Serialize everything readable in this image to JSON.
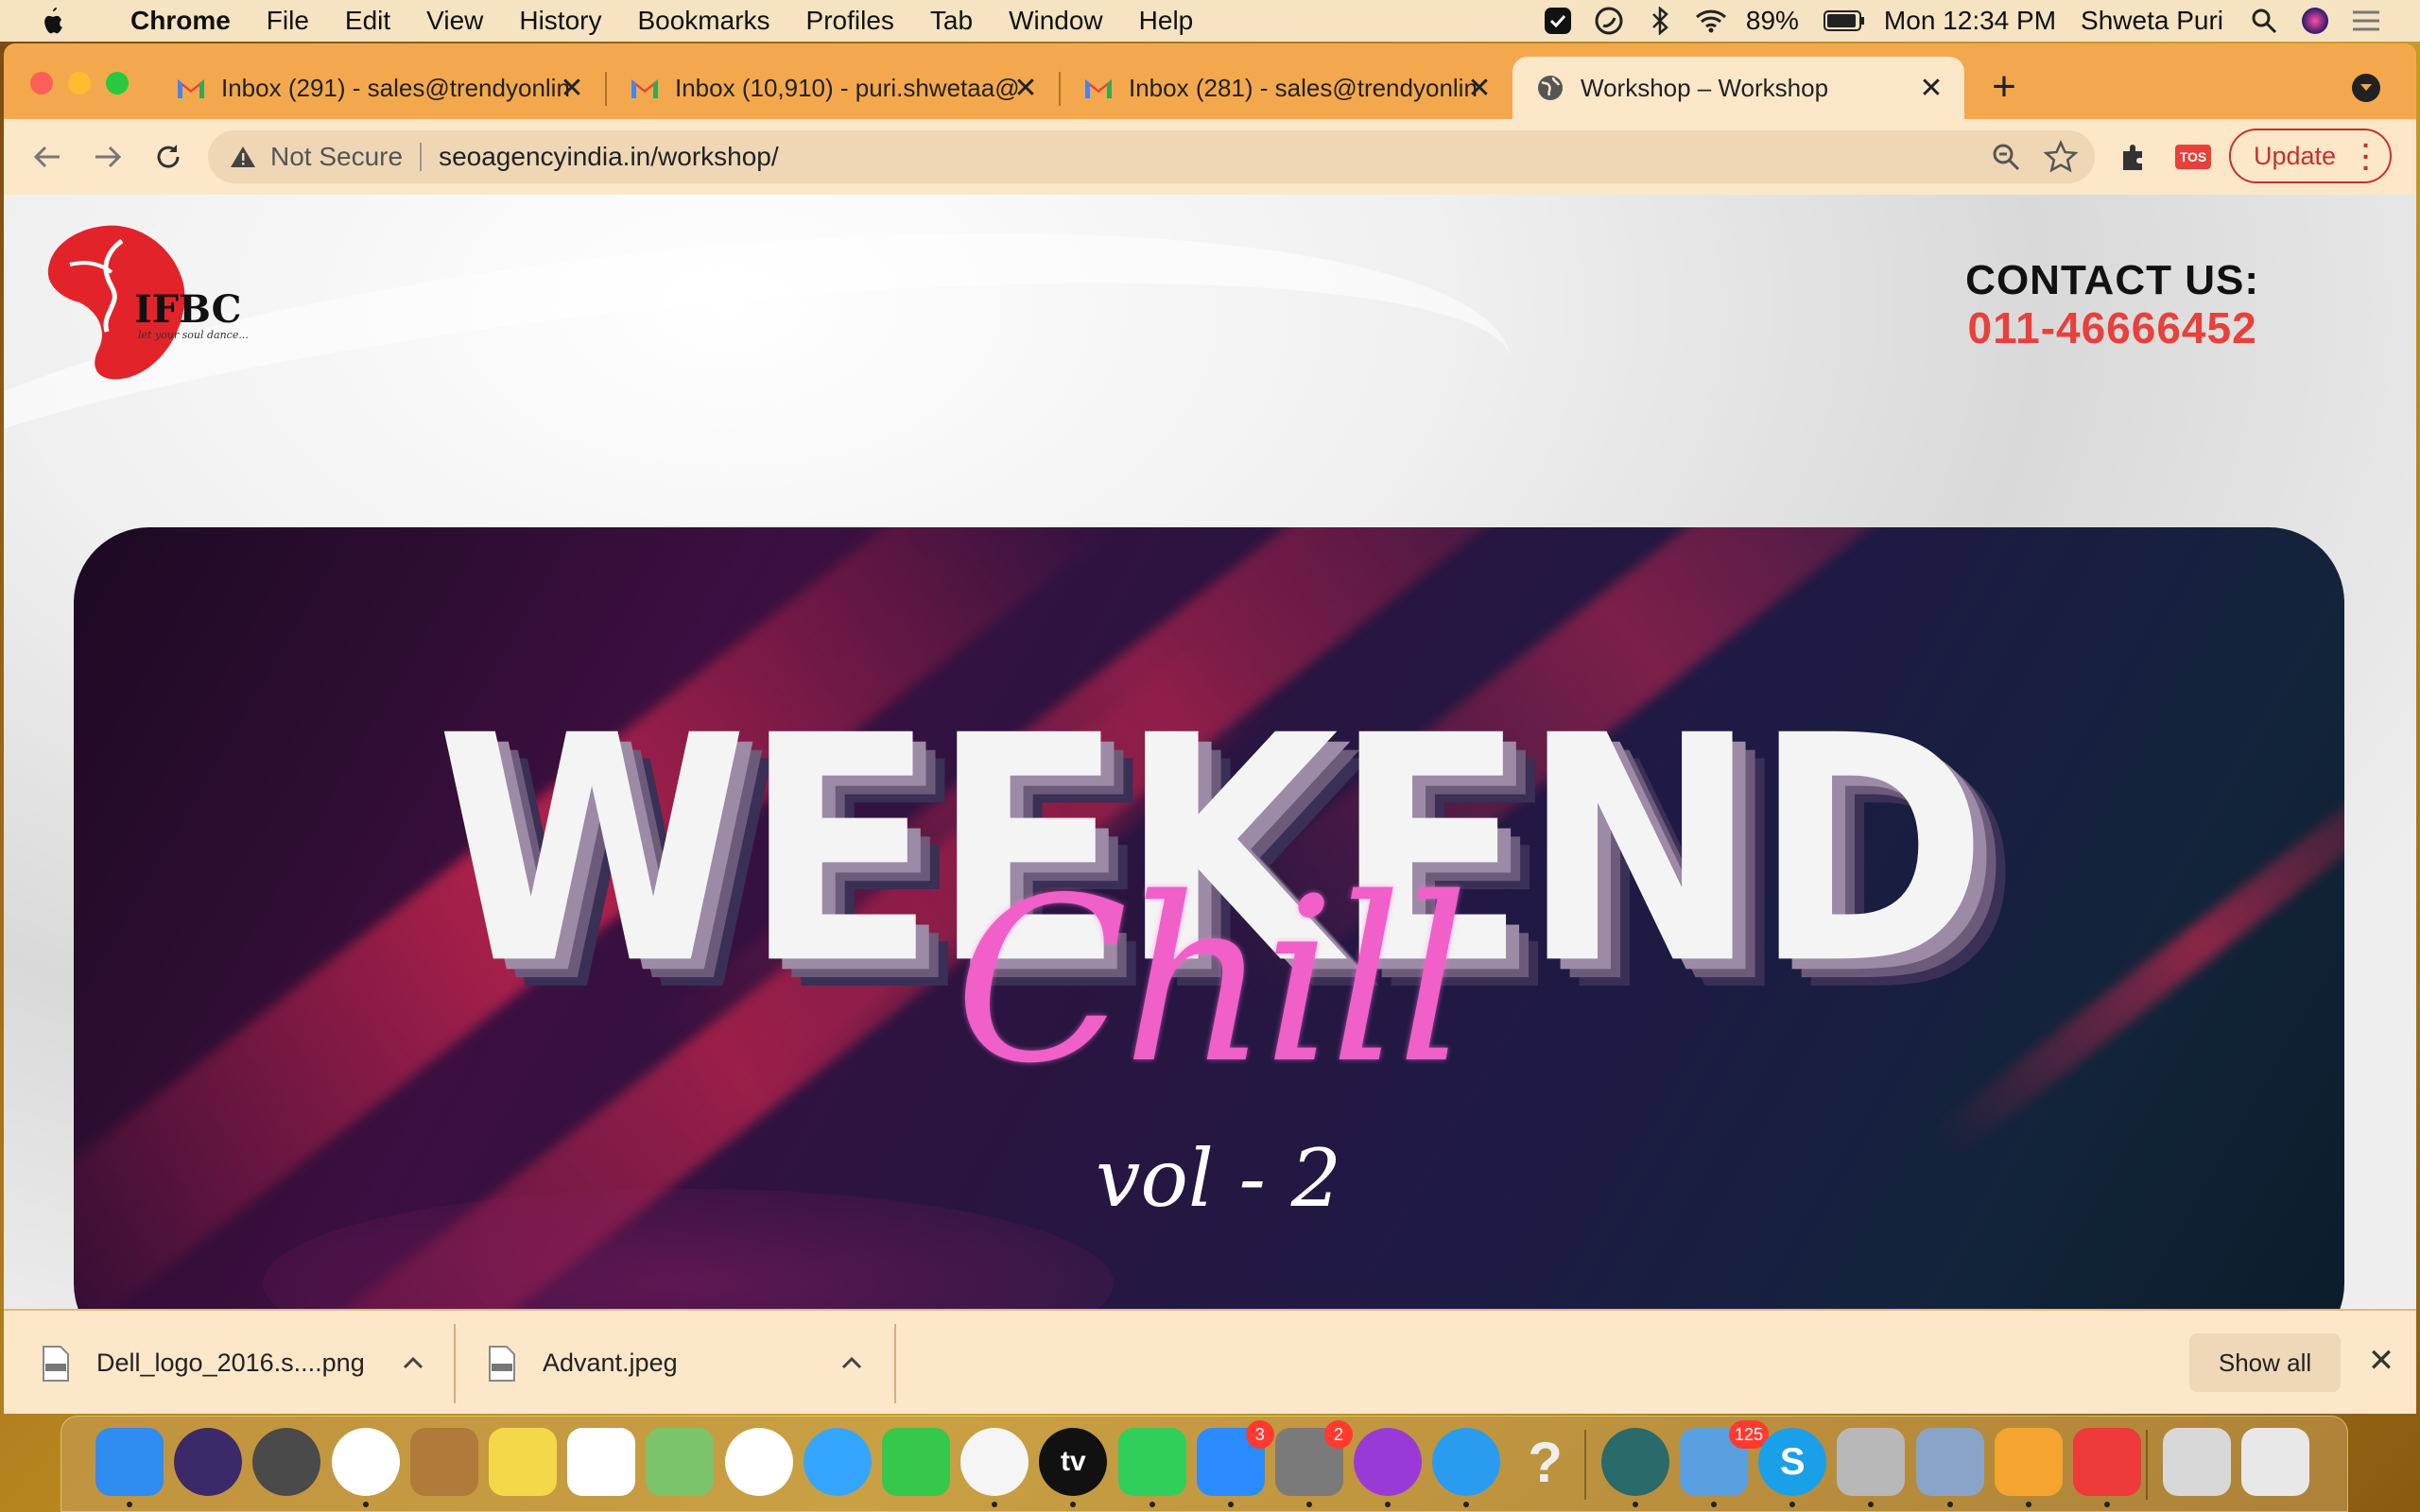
{
  "menubar": {
    "app_name": "Chrome",
    "items": [
      "File",
      "Edit",
      "View",
      "History",
      "Bookmarks",
      "Profiles",
      "Tab",
      "Window",
      "Help"
    ],
    "battery": "89%",
    "clock": "Mon 12:34 PM",
    "user": "Shweta Puri"
  },
  "tabs": [
    {
      "title": "Inbox (291) - sales@trendyonline",
      "icon": "gmail-icon"
    },
    {
      "title": "Inbox (10,910) - puri.shwetaa@",
      "icon": "gmail-icon"
    },
    {
      "title": "Inbox (281) - sales@trendyonline",
      "icon": "gmail-icon"
    },
    {
      "title": "Workshop – Workshop",
      "icon": "globe-icon",
      "active": true
    }
  ],
  "omnibox": {
    "security": "Not Secure",
    "url": "seoagencyindia.in/workshop/"
  },
  "toolbar": {
    "update_label": "Update",
    "extension_label": "TOS"
  },
  "page": {
    "logo_text": "IFBC",
    "logo_tagline": "let your soul dance...",
    "contact_label": "CONTACT US:",
    "contact_phone": "011-46666452",
    "banner": {
      "headline": "WEEKEND",
      "script": "Chill",
      "volume": "vol - 2"
    }
  },
  "downloads": {
    "files": [
      {
        "name": "Dell_logo_2016.s....png",
        "type": "PNG"
      },
      {
        "name": "Advant.jpeg",
        "type": "JPEG"
      }
    ],
    "show_all_label": "Show all"
  },
  "dock": {
    "apps": [
      {
        "name": "Finder",
        "color": "#2f8cf0"
      },
      {
        "name": "Siri",
        "color": "#3a2a6a"
      },
      {
        "name": "Launchpad",
        "color": "#4a4a4a"
      },
      {
        "name": "Chrome",
        "color": "#ffffff"
      },
      {
        "name": "Contacts",
        "color": "#b07a3a"
      },
      {
        "name": "Notes",
        "color": "#f5d84a"
      },
      {
        "name": "Reminders",
        "color": "#ffffff"
      },
      {
        "name": "Maps",
        "color": "#7cc46a"
      },
      {
        "name": "Photos",
        "color": "#ffffff"
      },
      {
        "name": "Messages",
        "color": "#35a6ff"
      },
      {
        "name": "FaceTime",
        "color": "#36c84a"
      },
      {
        "name": "Music",
        "color": "#f5f5f5"
      },
      {
        "name": "TV",
        "color": "#111111"
      },
      {
        "name": "WhatsApp",
        "color": "#2fcf5a"
      },
      {
        "name": "App Store",
        "color": "#2a8cff",
        "badge": "3"
      },
      {
        "name": "System Preferences",
        "color": "#7a7a7a",
        "badge": "2"
      },
      {
        "name": "Podcasts",
        "color": "#9a3ad6"
      },
      {
        "name": "Safari",
        "color": "#2a9cf0"
      },
      {
        "name": "Help",
        "color": "#c8b080"
      },
      {
        "name": "Camo",
        "color": "#2a6a6a"
      },
      {
        "name": "Mail",
        "color": "#5aa0e0",
        "badge": "125"
      },
      {
        "name": "Skype",
        "color": "#1aa0e8"
      },
      {
        "name": "Keychain Access",
        "color": "#b8b8b8"
      },
      {
        "name": "Preview",
        "color": "#8aa4c8"
      },
      {
        "name": "Pages",
        "color": "#f5a430"
      },
      {
        "name": "AnyDesk",
        "color": "#ee3a3a"
      },
      {
        "name": "Downloads",
        "color": "#d8d8d8"
      },
      {
        "name": "Trash",
        "color": "#e8e8e8"
      }
    ]
  }
}
